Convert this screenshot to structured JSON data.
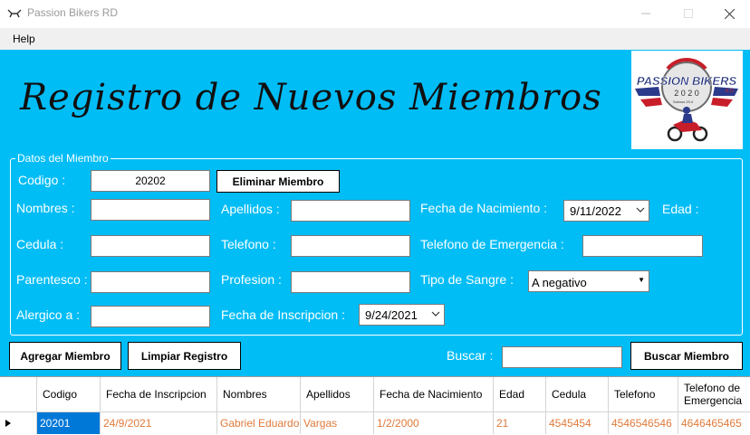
{
  "window": {
    "title": "Passion Bikers RD"
  },
  "menu": {
    "help": "Help"
  },
  "header": {
    "title": "Registro de Nuevos Miembros"
  },
  "logo": {
    "text": "PASSION BIKERS",
    "sub": "R.D.",
    "year": "2 0 2 0",
    "motto": "Salmos 23:4"
  },
  "group": {
    "title": "Datos del Miembro"
  },
  "form": {
    "codigo_label": "Codigo :",
    "codigo_value": "20202",
    "eliminar_label": "Eliminar Miembro",
    "nombres_label": "Nombres :",
    "apellidos_label": "Apellidos :",
    "fecha_nac_label": "Fecha de Nacimiento :",
    "fecha_nac_value": "9/11/2022",
    "edad_label": "Edad :",
    "cedula_label": "Cedula :",
    "telefono_label": "Telefono :",
    "tel_emergencia_label": "Telefono de Emergencia :",
    "parentesco_label": "Parentesco :",
    "profesion_label": "Profesion :",
    "tipo_sangre_label": "Tipo de Sangre :",
    "tipo_sangre_value": "A negativo",
    "alergico_label": "Alergico a :",
    "fecha_insc_label": "Fecha de Inscripcion :",
    "fecha_insc_value": "9/24/2021"
  },
  "actions": {
    "agregar": "Agregar Miembro",
    "limpiar": "Limpiar Registro",
    "buscar_label": "Buscar :",
    "buscar_button": "Buscar Miembro"
  },
  "grid": {
    "headers": [
      "Codigo",
      "Fecha de Inscripcion",
      "Nombres",
      "Apellidos",
      "Fecha de Nacimiento",
      "Edad",
      "Cedula",
      "Telefono",
      "Telefono de Emergencia"
    ],
    "rows": [
      [
        "20201",
        "24/9/2021",
        "Gabriel Eduardo",
        "Vargas",
        "1/2/2000",
        "21",
        "4545454",
        "4546546546",
        "4646465465"
      ]
    ]
  },
  "colors": {
    "background": "#00bdf6",
    "cell_text": "#e07a3a",
    "selected_cell": "#0078d7"
  }
}
